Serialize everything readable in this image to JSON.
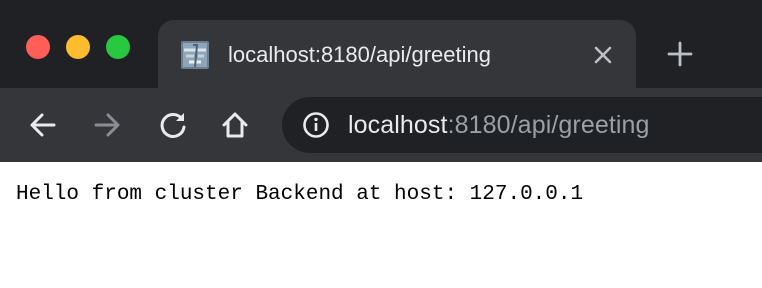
{
  "tab": {
    "title": "localhost:8180/api/greeting",
    "favicon": "page-favicon-icon"
  },
  "omnibox": {
    "url_host": "localhost",
    "url_rest": ":8180/api/greeting",
    "info_icon": "info-icon"
  },
  "toolbar": {
    "back_icon": "back-arrow-icon",
    "forward_icon": "forward-arrow-icon",
    "reload_icon": "reload-icon",
    "home_icon": "home-icon"
  },
  "page": {
    "body_text": "Hello from cluster Backend at host: 127.0.0.1"
  },
  "colors": {
    "tabstrip_bg": "#202124",
    "toolbar_bg": "#35363a",
    "traffic_red": "#ff5f57",
    "traffic_yellow": "#febc2e",
    "traffic_green": "#28c840"
  }
}
